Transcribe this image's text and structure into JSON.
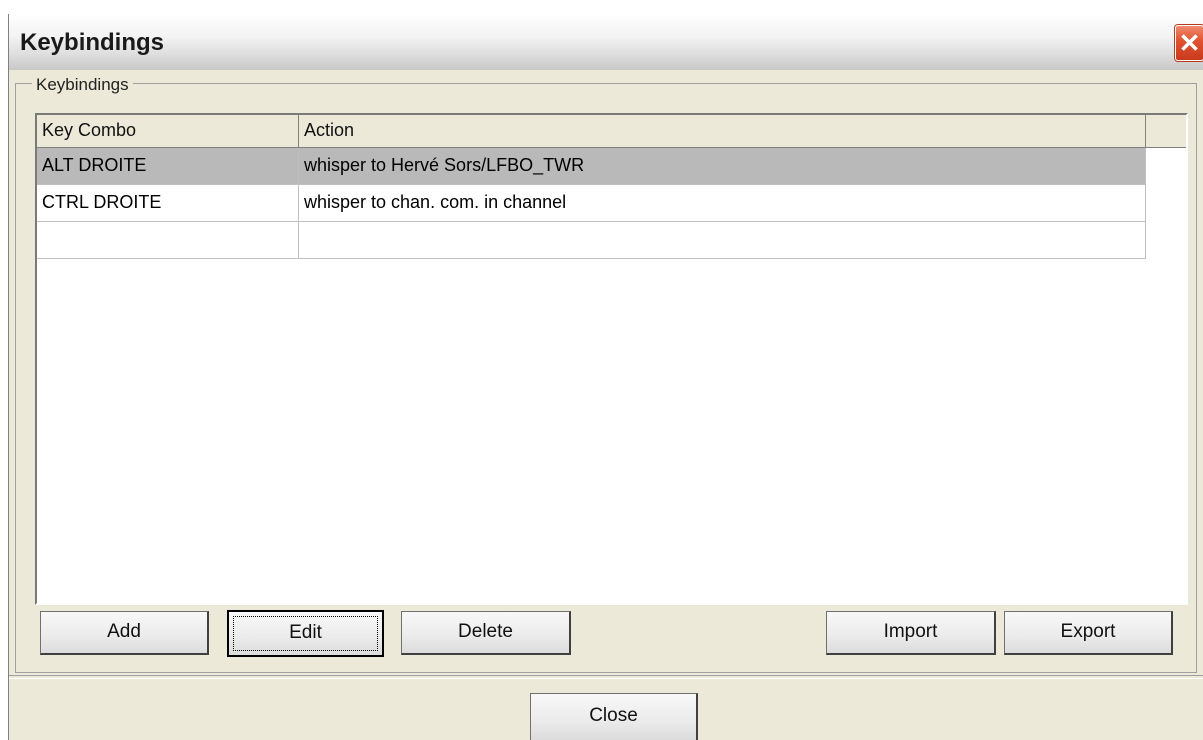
{
  "window": {
    "title": "Keybindings",
    "close_glyph": "✕"
  },
  "group": {
    "label": "Keybindings"
  },
  "table": {
    "columns": [
      "Key Combo",
      "Action"
    ],
    "rows": [
      {
        "key": "ALT DROITE",
        "action": "whisper to Hervé Sors/LFBO_TWR",
        "selected": true
      },
      {
        "key": "CTRL DROITE",
        "action": "whisper to chan. com. in channel",
        "selected": false
      },
      {
        "key": "",
        "action": "",
        "selected": false
      }
    ]
  },
  "buttons": {
    "add": "Add",
    "edit": "Edit",
    "delete": "Delete",
    "import": "Import",
    "export": "Export",
    "close": "Close"
  },
  "colors": {
    "dialog_bg": "#ece9d8",
    "selection": "#b9b9b9",
    "close_button": "#e0512f"
  }
}
